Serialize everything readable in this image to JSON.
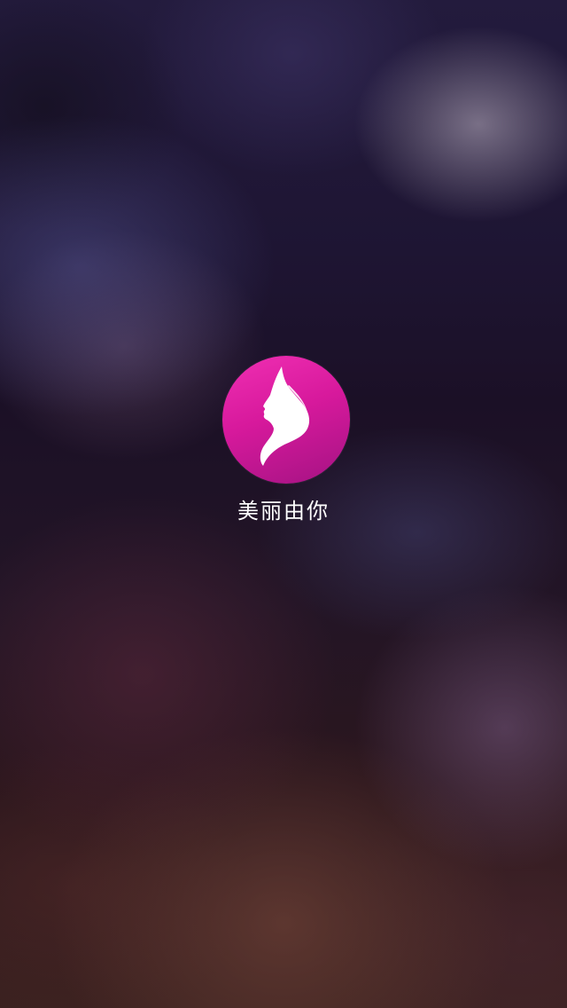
{
  "splash": {
    "app_name": "美丽由你",
    "logo_icon": "woman-silhouette-icon",
    "logo_color": "#e0219f",
    "text_color": "#ffffff"
  }
}
